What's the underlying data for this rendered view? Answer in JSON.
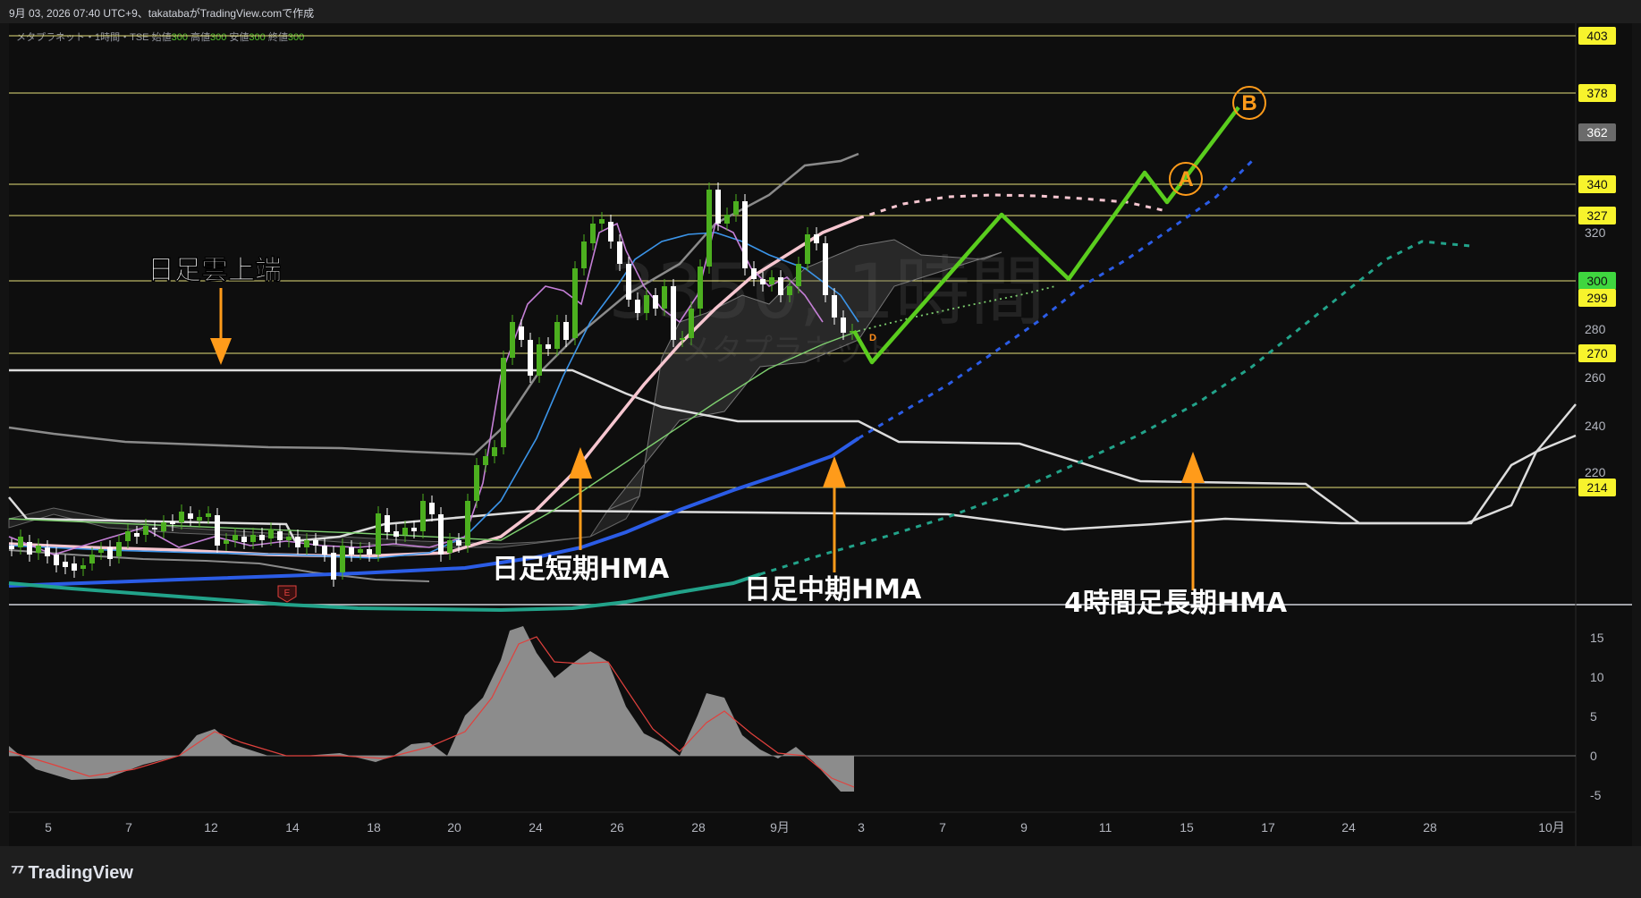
{
  "header": {
    "created": "9月 03, 2026 07:40 UTC+9、takatabaがTradingView.comで作成"
  },
  "symbol": {
    "name": "メタプラネット・1時間・TSE",
    "o_label": "始値",
    "o": "300",
    "h_label": "高値",
    "h": "300",
    "l_label": "安値",
    "l": "300",
    "c_label": "終値",
    "c": "300"
  },
  "watermark": {
    "code": "3350, 1時間",
    "name": "メタプラネット"
  },
  "brand": "TradingView",
  "colors": {
    "background": "#0e0e0e",
    "candle_up": "#4caf1f",
    "candle_down": "#ffffff",
    "hline": "#e6e07a",
    "price_tag_yellow": "#f7f32c",
    "price_tag_green": "#3fd63f",
    "price_tag_gray": "#6b6b6b",
    "annotation_arrow": "#ff9b1a",
    "projection": "#5acd1e",
    "hma_short": "#f6c6d0",
    "hma_mid": "#2b5ce6",
    "hma_long": "#22a38a"
  },
  "annotations": [
    {
      "id": "cloud",
      "text": "日足雲上端"
    },
    {
      "id": "short",
      "text": "日足短期HMA"
    },
    {
      "id": "mid",
      "text": "日足中期HMA"
    },
    {
      "id": "long",
      "text": "4時間足長期HMA"
    }
  ],
  "wave_labels": [
    "A",
    "B"
  ],
  "event_marker": "E",
  "dividend_marker": "D",
  "chart_data": [
    {
      "type": "line",
      "panel": "price",
      "y_axis_ticks": [
        320,
        280,
        260,
        240,
        220
      ],
      "ylim": [
        210,
        410
      ],
      "price_tags": [
        {
          "value": "403",
          "style": "yellow"
        },
        {
          "value": "378",
          "style": "yellow"
        },
        {
          "value": "362",
          "style": "gray"
        },
        {
          "value": "340",
          "style": "yellow"
        },
        {
          "value": "327",
          "style": "yellow"
        },
        {
          "value": "300",
          "style": "green"
        },
        {
          "value": "299",
          "style": "yellow"
        },
        {
          "value": "270",
          "style": "yellow"
        },
        {
          "value": "214",
          "style": "yellow"
        }
      ],
      "horizontal_lines": [
        403,
        378,
        340,
        327,
        300,
        270,
        214
      ],
      "x_tick_labels": [
        "5",
        "7",
        "12",
        "14",
        "18",
        "20",
        "24",
        "26",
        "28",
        "9月",
        "3",
        "7",
        "9",
        "11",
        "15",
        "17",
        "24",
        "28",
        "10月"
      ],
      "projection_path": [
        300,
        289,
        340,
        318,
        358,
        346,
        381
      ]
    },
    {
      "type": "area",
      "panel": "oscillator",
      "y_axis_ticks": [
        "15",
        "10",
        "5",
        "0",
        "-5"
      ],
      "ylim": [
        -7,
        17
      ]
    }
  ]
}
